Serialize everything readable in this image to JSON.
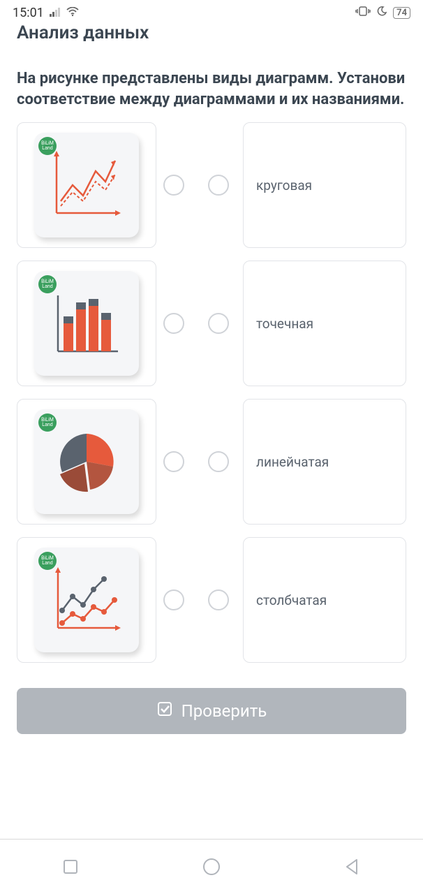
{
  "status": {
    "time": "15:01",
    "battery": "74"
  },
  "page": {
    "title": "Анализ данных",
    "question": "На рисунке представлены виды диаграмм. Установи соответствие между диаграммами и их названиями."
  },
  "badge_label": "BiLiM Land",
  "labels": {
    "row1": "круговая",
    "row2": "точечная",
    "row3": "линейчатая",
    "row4": "столбчатая"
  },
  "button": {
    "check": "Проверить"
  }
}
